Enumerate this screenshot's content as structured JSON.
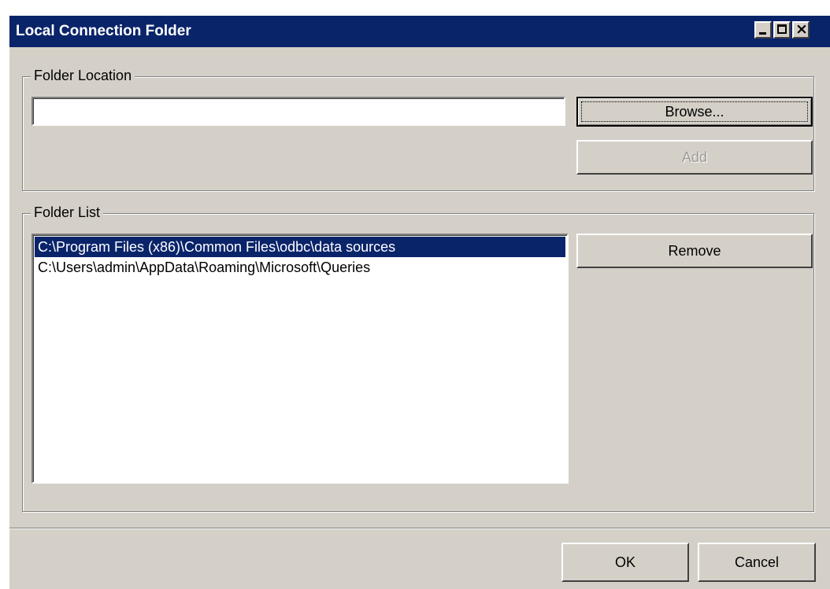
{
  "window": {
    "title": "Local Connection Folder"
  },
  "folder_location": {
    "legend": "Folder Location",
    "path_value": "",
    "browse_label": "Browse...",
    "add_label": "Add"
  },
  "folder_list": {
    "legend": "Folder List",
    "items": [
      {
        "path": "C:\\Program Files (x86)\\Common Files\\odbc\\data sources",
        "selected": true
      },
      {
        "path": "C:\\Users\\admin\\AppData\\Roaming\\Microsoft\\Queries",
        "selected": false
      }
    ],
    "remove_label": "Remove"
  },
  "footer": {
    "ok_label": "OK",
    "cancel_label": "Cancel"
  },
  "colors": {
    "titlebar": "#0a246a",
    "dialog_face": "#d4d0c8",
    "selection": "#0a246a"
  }
}
